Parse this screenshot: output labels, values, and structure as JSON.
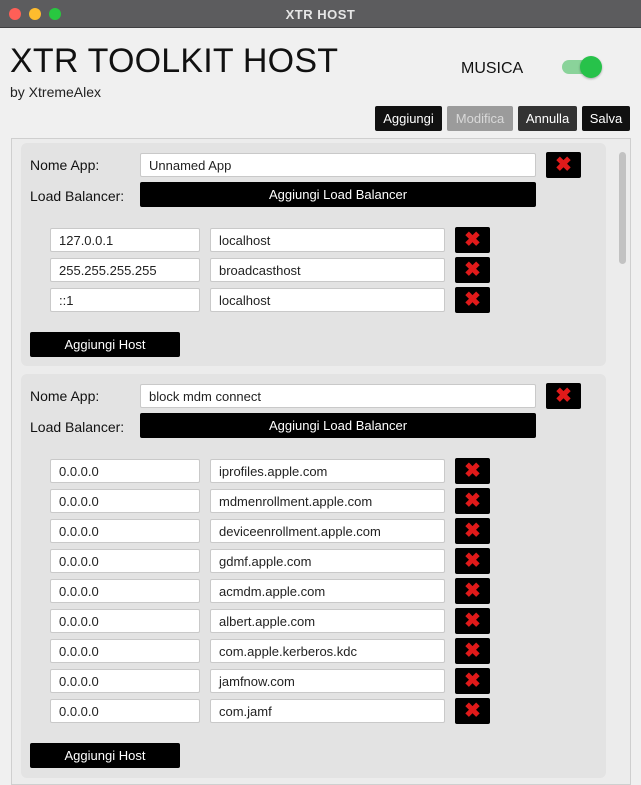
{
  "window": {
    "title": "XTR HOST"
  },
  "header": {
    "title": "XTR TOOLKIT HOST",
    "subtitle": "by XtremeAlex",
    "music_label": "MUSICA",
    "music_on": true
  },
  "toolbar": {
    "add": "Aggiungi",
    "edit": "Modifica",
    "cancel": "Annulla",
    "save": "Salva"
  },
  "labels": {
    "app_name": "Nome App:",
    "load_balancer": "Load Balancer:",
    "add_load_balancer": "Aggiungi Load Balancer",
    "add_host": "Aggiungi Host"
  },
  "icons": {
    "delete": "close-x-icon"
  },
  "colors": {
    "delete_icon": "#e01a1a",
    "toggle_on": "#27c24a"
  },
  "apps": [
    {
      "name": "Unnamed App",
      "hosts": [
        {
          "ip": "127.0.0.1",
          "host": "localhost"
        },
        {
          "ip": "255.255.255.255",
          "host": "broadcasthost"
        },
        {
          "ip": "::1",
          "host": "localhost"
        }
      ]
    },
    {
      "name": "block mdm connect",
      "hosts": [
        {
          "ip": "0.0.0.0",
          "host": "iprofiles.apple.com"
        },
        {
          "ip": "0.0.0.0",
          "host": "mdmenrollment.apple.com"
        },
        {
          "ip": "0.0.0.0",
          "host": "deviceenrollment.apple.com"
        },
        {
          "ip": "0.0.0.0",
          "host": "gdmf.apple.com"
        },
        {
          "ip": "0.0.0.0",
          "host": "acmdm.apple.com"
        },
        {
          "ip": "0.0.0.0",
          "host": "albert.apple.com"
        },
        {
          "ip": "0.0.0.0",
          "host": "com.apple.kerberos.kdc"
        },
        {
          "ip": "0.0.0.0",
          "host": "jamfnow.com"
        },
        {
          "ip": "0.0.0.0",
          "host": "com.jamf"
        }
      ]
    }
  ]
}
